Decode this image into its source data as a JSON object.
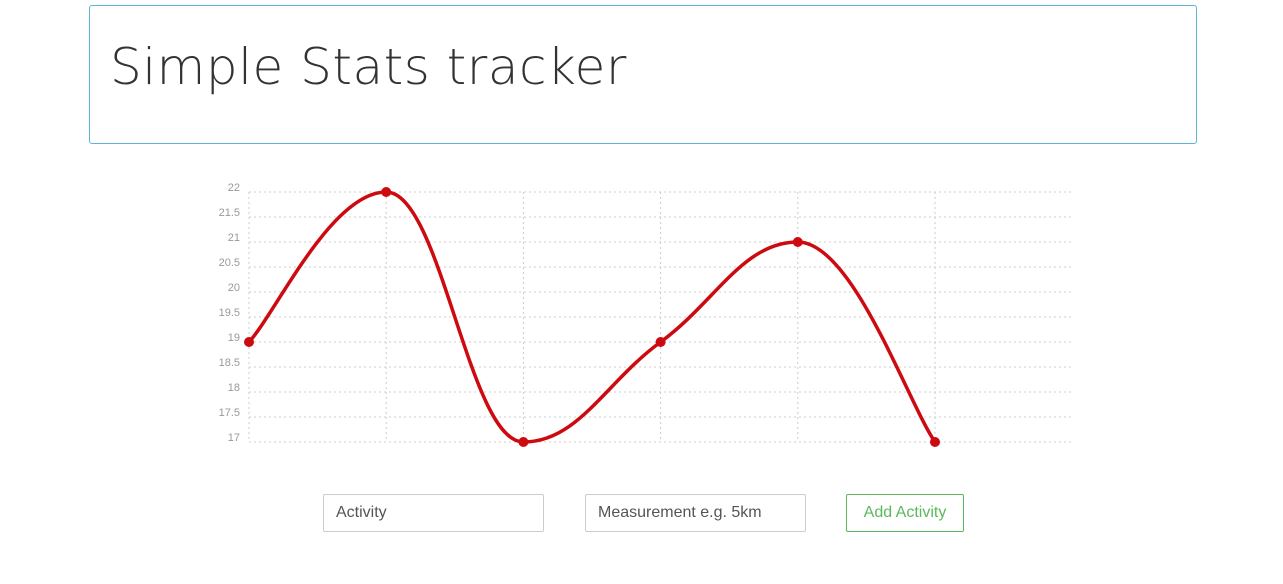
{
  "header": {
    "title": "Simple Stats tracker"
  },
  "chart_data": {
    "type": "line",
    "x": [
      1,
      2,
      3,
      4,
      5,
      6
    ],
    "series": [
      {
        "values": [
          19,
          22,
          17,
          19,
          21,
          17
        ]
      }
    ],
    "yticks": [
      "22",
      "21.5",
      "21",
      "20.5",
      "20",
      "19.5",
      "19",
      "18.5",
      "18",
      "17.5",
      "17"
    ],
    "ylim": [
      17,
      22
    ],
    "grid": true,
    "smooth": true,
    "line_color": "#cc0a10",
    "grid_color": "#cccccc"
  },
  "form": {
    "activity_placeholder": "Activity",
    "measurement_placeholder": "Measurement e.g. 5km",
    "add_label": "Add Activity"
  },
  "colors": {
    "accent_border": "#5bb6d6",
    "button_green": "#5cb85c"
  }
}
